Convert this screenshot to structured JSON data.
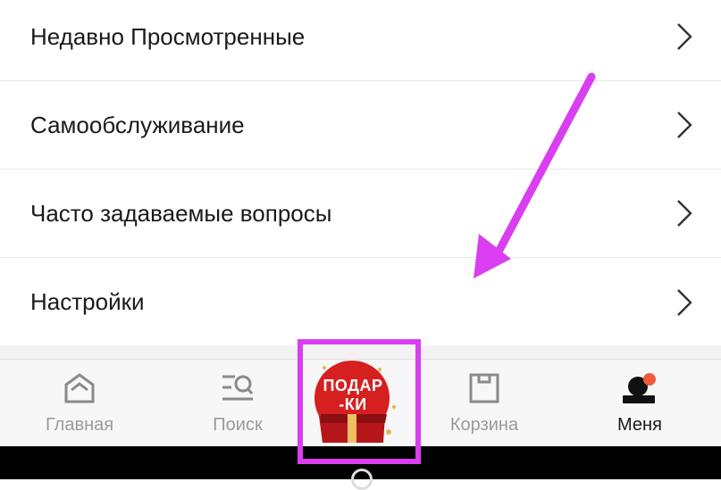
{
  "menu": {
    "items": [
      {
        "label": "Недавно Просмотренные"
      },
      {
        "label": "Самообслуживание"
      },
      {
        "label": "Часто задаваемые вопросы"
      },
      {
        "label": "Настройки"
      }
    ]
  },
  "tabbar": {
    "tabs": [
      {
        "label": "Главная",
        "icon": "home-icon"
      },
      {
        "label": "Поиск",
        "icon": "search-list-icon"
      },
      {
        "label": "ПОДАР-КИ",
        "icon": "gift-box-icon"
      },
      {
        "label": "Корзина",
        "icon": "cart-bag-icon"
      },
      {
        "label": "Меня",
        "icon": "profile-icon",
        "active": true
      }
    ],
    "gift_line1": "ПОДАР",
    "gift_line2": "-КИ"
  },
  "colors": {
    "annotation": "#d93ef0",
    "notification_dot": "#f05a3c",
    "gift_red": "#d61f1f"
  }
}
